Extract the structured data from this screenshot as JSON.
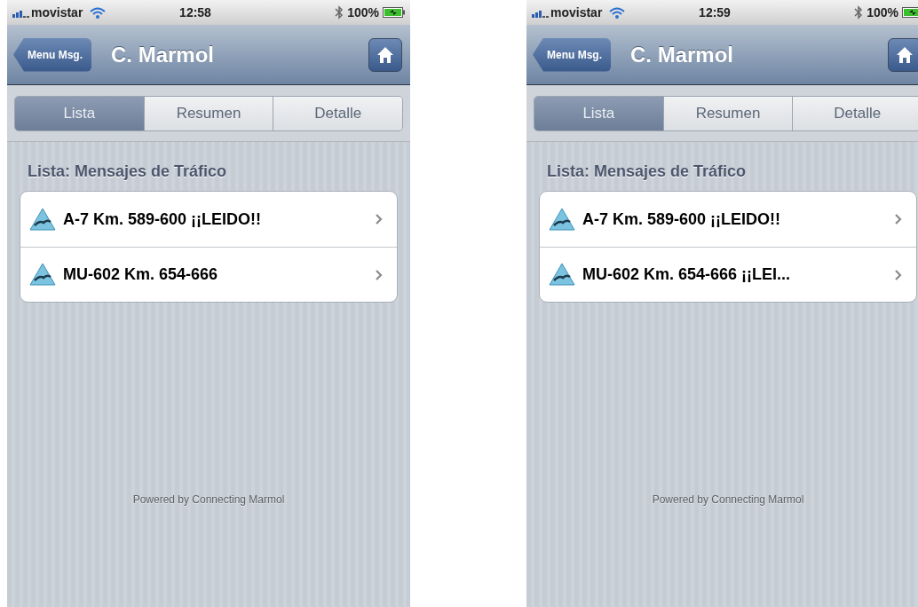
{
  "screens": [
    {
      "status_bar": {
        "carrier": "movistar",
        "time": "12:58",
        "battery": "100%"
      },
      "nav": {
        "back": "Menu Msg.",
        "title": "C. Marmol"
      },
      "tabs": [
        {
          "label": "Lista",
          "selected": true
        },
        {
          "label": "Resumen",
          "selected": false
        },
        {
          "label": "Detalle",
          "selected": false
        }
      ],
      "section_title": "Lista: Mensajes de Tráfico",
      "rows": [
        {
          "title": "A-7 Km. 589-600 ¡¡LEIDO!!"
        },
        {
          "title": "MU-602 Km. 654-666"
        }
      ],
      "footer": "Powered by Connecting Marmol"
    },
    {
      "status_bar": {
        "carrier": "movistar",
        "time": "12:59",
        "battery": "100%"
      },
      "nav": {
        "back": "Menu Msg.",
        "title": "C. Marmol"
      },
      "tabs": [
        {
          "label": "Lista",
          "selected": true
        },
        {
          "label": "Resumen",
          "selected": false
        },
        {
          "label": "Detalle",
          "selected": false
        }
      ],
      "section_title": "Lista: Mensajes de Tráfico",
      "rows": [
        {
          "title": "A-7 Km. 589-600 ¡¡LEIDO!!"
        },
        {
          "title": "MU-602 Km. 654-666 ¡¡LEI..."
        }
      ],
      "footer": "Powered by Connecting Marmol"
    }
  ]
}
